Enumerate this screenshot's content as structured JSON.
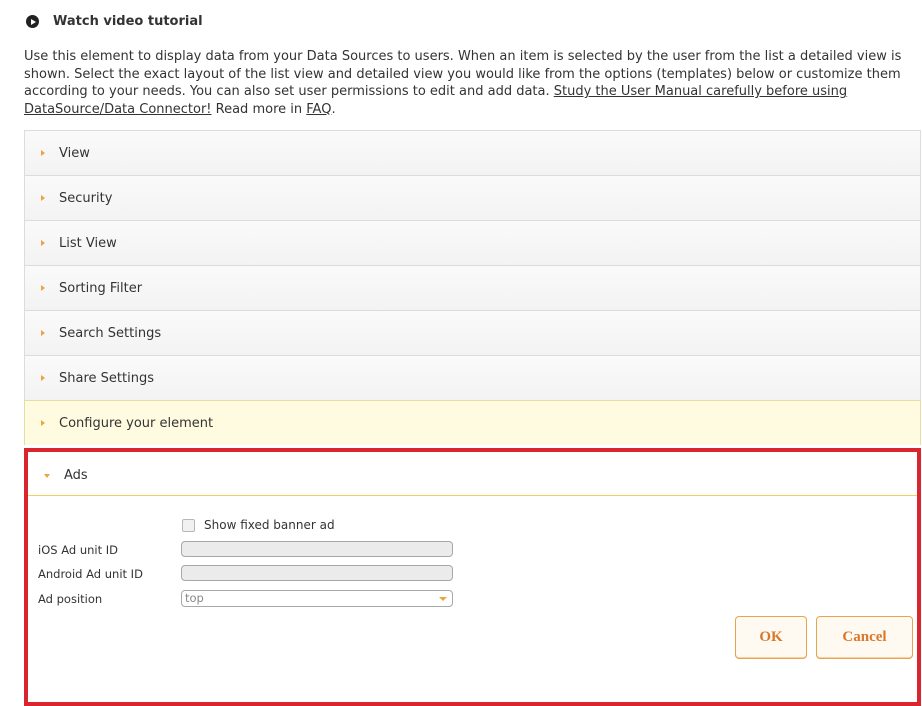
{
  "video": {
    "label": "Watch video tutorial"
  },
  "description": {
    "text": "Use this element to display data from your Data Sources to users. When an item is selected by the user from the list a detailed view is shown. Select the exact layout of the list view and detailed view you would like from the options (templates) below or customize them according to your needs. You can also set user permissions to edit and add data. ",
    "manual_link": "Study the User Manual carefully before using DataSource/Data Connector!",
    "read_more": " Read more in ",
    "faq_link": "FAQ",
    "end": "."
  },
  "sections": [
    {
      "label": "View"
    },
    {
      "label": "Security"
    },
    {
      "label": "List View"
    },
    {
      "label": "Sorting Filter"
    },
    {
      "label": "Search Settings"
    },
    {
      "label": "Share Settings"
    },
    {
      "label": "Configure your element"
    },
    {
      "label": "Ads"
    }
  ],
  "ads": {
    "checkbox_label": "Show fixed banner ad",
    "ios_label": "iOS Ad unit ID",
    "android_label": "Android Ad unit ID",
    "position_label": "Ad position",
    "position_value": "top"
  },
  "buttons": {
    "ok": "OK",
    "cancel": "Cancel"
  },
  "colors": {
    "accent": "#e8a640",
    "highlight_border": "#d9262e",
    "button_text": "#d9782a"
  }
}
